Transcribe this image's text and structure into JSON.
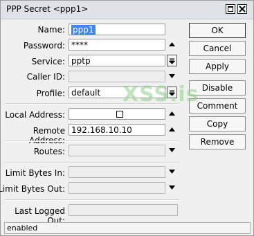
{
  "window": {
    "title": "PPP Secret <ppp1>",
    "icons": [
      "maximize-icon",
      "close-icon"
    ]
  },
  "form": {
    "name": {
      "label": "Name:",
      "value": "ppp1"
    },
    "password": {
      "label": "Password:",
      "value": "****"
    },
    "service": {
      "label": "Service:",
      "value": "pptp"
    },
    "caller_id": {
      "label": "Caller ID:",
      "value": ""
    },
    "profile": {
      "label": "Profile:",
      "value": "default"
    },
    "local_address": {
      "label": "Local Address:",
      "value": ""
    },
    "remote_address": {
      "label": "Remote Address:",
      "value": "192.168.10.10"
    },
    "routes": {
      "label": "Routes:",
      "value": ""
    },
    "limit_bytes_in": {
      "label": "Limit Bytes In:",
      "value": ""
    },
    "limit_bytes_out": {
      "label": "Limit Bytes Out:",
      "value": ""
    },
    "last_logged_out": {
      "label": "Last Logged Out:",
      "value": ""
    }
  },
  "buttons": {
    "ok": "OK",
    "cancel": "Cancel",
    "apply": "Apply",
    "disable": "Disable",
    "comment": "Comment",
    "copy": "Copy",
    "remove": "Remove"
  },
  "watermark": "XSS.is",
  "status": "enabled",
  "colors": {
    "selection": "#3d84ff",
    "watermark": "#8fd08a",
    "titlebar": "#dfe3e8"
  }
}
